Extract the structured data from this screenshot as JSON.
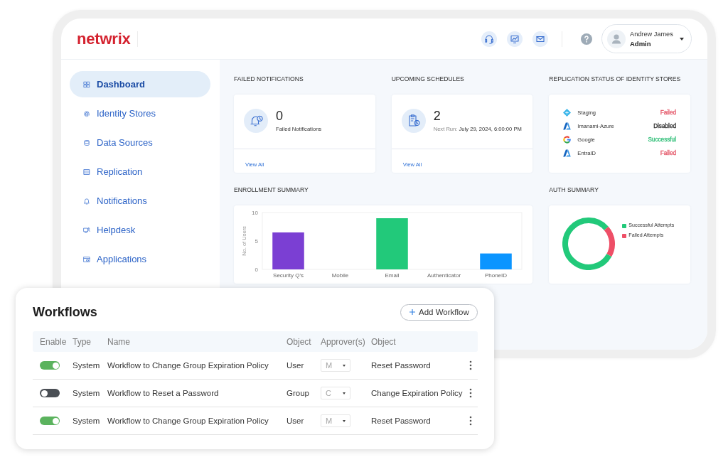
{
  "dashboard": {
    "header": {
      "logo": "netwrix",
      "user": {
        "name": "Andrew James",
        "role": "Admin"
      }
    },
    "sidebar": {
      "items": [
        {
          "label": "Dashboard",
          "selected": true
        },
        {
          "label": "Identity Stores",
          "selected": false
        },
        {
          "label": "Data Sources",
          "selected": false
        },
        {
          "label": "Replication",
          "selected": false
        },
        {
          "label": "Notifications",
          "selected": false
        },
        {
          "label": "Helpdesk",
          "selected": false
        },
        {
          "label": "Applications",
          "selected": false
        }
      ]
    },
    "failed_notifications": {
      "title": "FAILED NOTIFICATIONS",
      "count": "0",
      "caption": "Failed Notifications",
      "link": "View All"
    },
    "upcoming_schedules": {
      "title": "UPCOMING SCHEDULES",
      "count": "2",
      "next_run_label": "Next Run:",
      "next_run_date": "July 29, 2024, 6:00:00 PM",
      "link": "View All"
    },
    "replication_status": {
      "title": "REPLICATION STATUS OF IDENTITY STORES",
      "stores": [
        {
          "kind": "diamond",
          "name": "Staging",
          "status": "Failed",
          "color": "#e55b6c"
        },
        {
          "kind": "wedge",
          "name": "Imanami-Azure",
          "status": "Disabled",
          "color": "#333333"
        },
        {
          "kind": "gmark",
          "name": "Google",
          "status": "Successful",
          "color": "#35c07b"
        },
        {
          "kind": "wedge",
          "name": "EntraID",
          "status": "Failed",
          "color": "#e55b6c"
        }
      ]
    },
    "enrollment_summary": {
      "title": "ENROLLMENT SUMMARY",
      "chart_data": {
        "type": "bar",
        "ylabel": "No. of Users",
        "categories": [
          "Security Q's",
          "Mobile",
          "Email",
          "Authenticator",
          "PhoneID"
        ],
        "values": [
          6.5,
          0,
          9,
          0,
          2.8
        ],
        "colors": [
          "#7b3fd3",
          null,
          "#22c97a",
          null,
          "#0b95ff"
        ],
        "ylim": [
          0,
          10
        ],
        "yticks": [
          0,
          5,
          10
        ]
      }
    },
    "auth_summary": {
      "title": "AUTH SUMMARY",
      "legend": [
        {
          "label": "Successful Attempts",
          "color": "#22c97a"
        },
        {
          "label": "Failed Attempts",
          "color": "#ee4f67"
        }
      ]
    }
  },
  "workflows": {
    "title": "Workflows",
    "add_button": "Add Workflow",
    "columns": [
      "Enable",
      "Type",
      "Name",
      "Object",
      "Approver(s)",
      "Object"
    ],
    "rows": [
      {
        "enabled": true,
        "type": "System",
        "name": "Workflow to Change Group Expiration Policy",
        "object": "User",
        "approver": "M",
        "object_2": "Reset Password"
      },
      {
        "enabled": false,
        "type": "System",
        "name": "Workflow to Reset a Password",
        "object": "Group",
        "approver": "C",
        "object_2": "Change Expiration Policy"
      },
      {
        "enabled": true,
        "type": "System",
        "name": "Workflow to Change Group Expiration Policy",
        "object": "User",
        "approver": "M",
        "object_2": "Reset Password"
      }
    ]
  }
}
